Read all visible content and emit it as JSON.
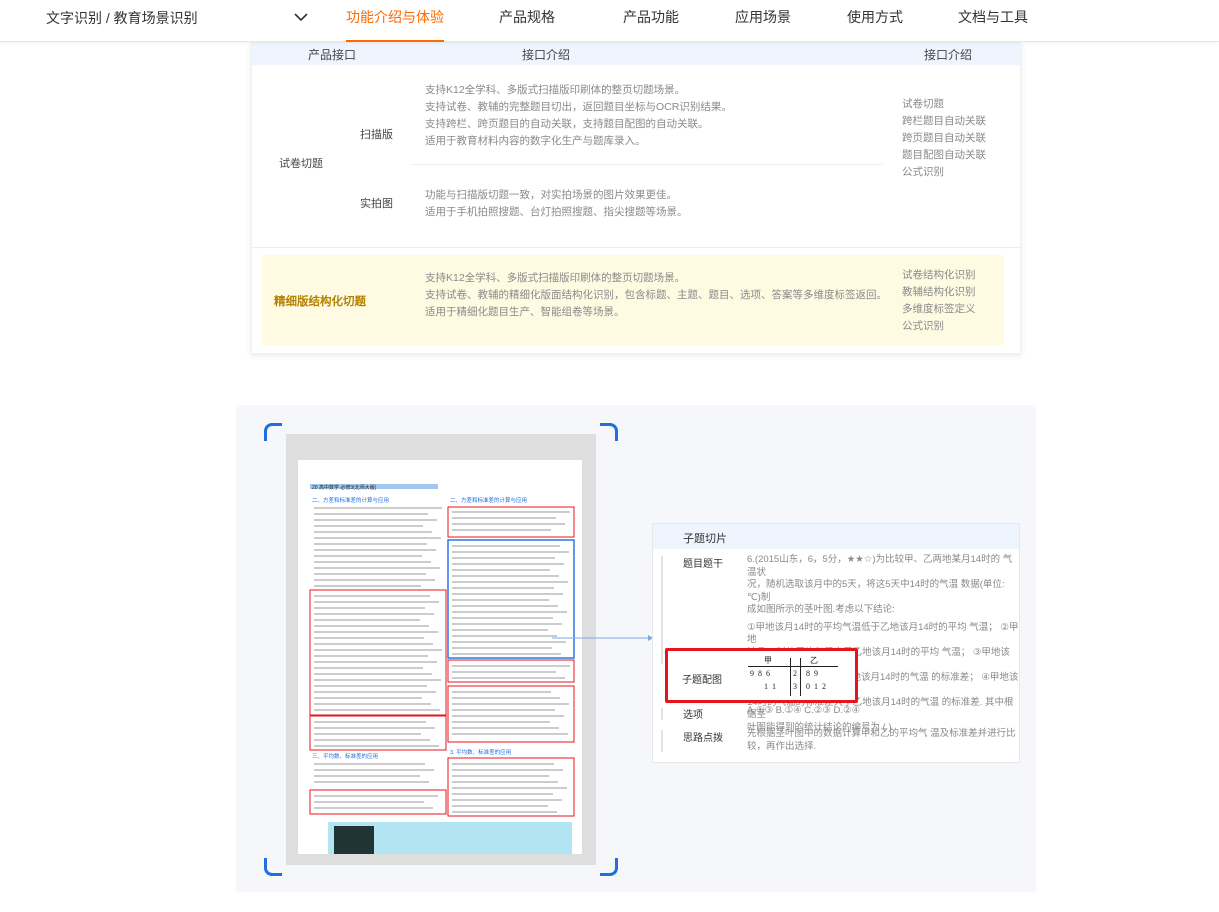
{
  "nav": {
    "breadcrumb": "文字识别 / 教育场景识别",
    "tabs": [
      "功能介绍与体验",
      "产品规格",
      "产品功能",
      "应用场景",
      "使用方式",
      "文档与工具"
    ],
    "active_tab": 0
  },
  "table": {
    "headers": [
      "产品接口",
      "接口介绍",
      "接口介绍"
    ],
    "group1": {
      "label": "试卷切题",
      "sub1": {
        "label": "扫描版",
        "lines": [
          "支持K12全学科、多版式扫描版印刷体的整页切题场景。",
          "支持试卷、教辅的完整题目切出，返回题目坐标与OCR识别结果。",
          "支持跨栏、跨页题目的自动关联，支持题目配图的自动关联。",
          "适用于教育材料内容的数字化生产与题库录入。"
        ]
      },
      "sub2": {
        "label": "实拍图",
        "lines": [
          "功能与扫描版切题一致，对实拍场景的图片效果更佳。",
          "适用于手机拍照搜题、台灯拍照搜题、指尖搜题等场景。"
        ]
      },
      "features": [
        "试卷切题",
        "跨栏题目自动关联",
        "跨页题目自动关联",
        "题目配图自动关联",
        "公式识别"
      ]
    },
    "group2": {
      "label": "精细版结构化切题",
      "lines": [
        "支持K12全学科、多版式扫描版印刷体的整页切题场景。",
        "支持试卷、教辅的精细化版面结构化识别，包含标题、主题、题目、选项、答案等多维度标签返回。",
        "适用于精细化题目生产、智能组卷等场景。"
      ],
      "features": [
        "试卷结构化识别",
        "教辅结构化识别",
        "多维度标签定义",
        "公式识别"
      ]
    }
  },
  "panel": {
    "title": "子题切片",
    "stem_label": "题目题干",
    "stem_lines": [
      "6.(2015山东，6，5分，★★☆)为比较甲、乙两地某月14时的 气温状",
      "况，随机选取该月中的5天，将这5天中14时的气温 数据(单位: ℃)制",
      "成如图所示的茎叶图.考虑以下结论:"
    ],
    "stem_lines2": [
      "①甲地该月14时的平均气温低于乙地该月14时的平均 气温；  ②甲地",
      "该月14时的平均气温高于乙地该月14时的平均 气温；  ③甲地该月14",
      "时的气温的标准差小于乙地该月14时的气温 的标准差；  ④甲地该月",
      "14时的气温的标准差大于乙地该月14时的气温 的标准差. 其中根据茎",
      "叶图能得到的统计结论的编号为 (  )"
    ],
    "figure_label": "子题配图",
    "stemleaf": {
      "left_head": "甲",
      "right_head": "乙",
      "row1_left": "9  8  6",
      "row1_stem": "2",
      "row1_right": "8  9",
      "row2_left": "1  1",
      "row2_stem": "3",
      "row2_right": "0  1  2"
    },
    "options_label": "选项",
    "options_text": "A.①③  B.①④  C.②③  D.②④",
    "hint_label": "思路点拨",
    "hint_lines": [
      "先根据茎叶图中的数据计算甲和乙的平均气 温及标准差并进行比",
      "较，再作出选择."
    ]
  },
  "doc": {
    "header": "20  高中数学 必修3(北师大版)",
    "sec1": "二、方差和标准差的计算与应用",
    "sec2": "二、方差和标准差的计算与应用",
    "sec3": "三、平均数、标准差的应用",
    "sec4": "3. 平均数、标准差的应用"
  },
  "colors": {
    "accent": "#ff6a00",
    "blue": "#1f6fe0",
    "red": "#e8141c",
    "highlight": "#fffbe2"
  }
}
